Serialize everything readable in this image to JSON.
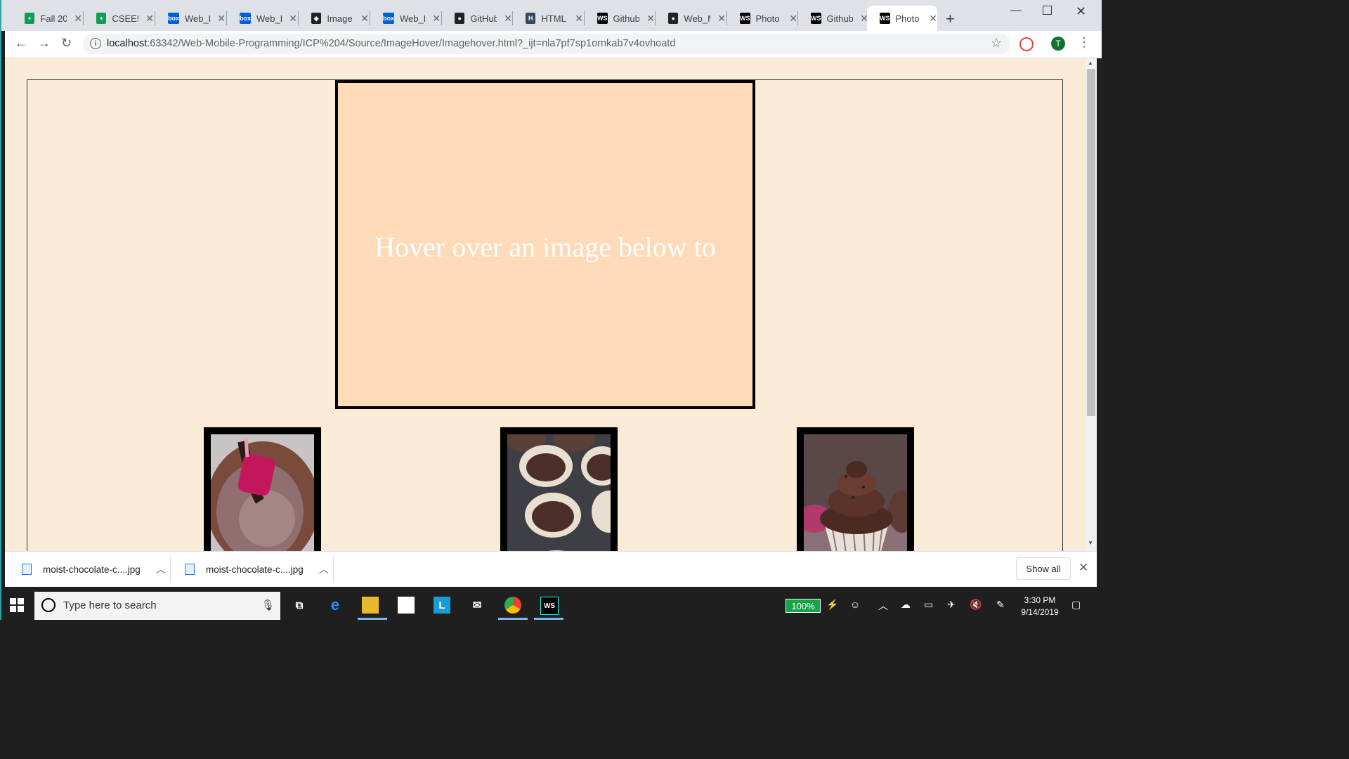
{
  "browser": {
    "tabs": [
      {
        "label": "Fall 20",
        "icon": "sheets-icon",
        "color": "#0f9d58",
        "glyph": "+"
      },
      {
        "label": "CSEE5",
        "icon": "sheets-icon",
        "color": "#0f9d58",
        "glyph": "+"
      },
      {
        "label": "Web_L",
        "icon": "box-icon",
        "color": "#0061d5",
        "glyph": "box"
      },
      {
        "label": "Web_L",
        "icon": "box-icon",
        "color": "#0061d5",
        "glyph": "box"
      },
      {
        "label": "Image",
        "icon": "codepen-icon",
        "color": "#222222",
        "glyph": "◈"
      },
      {
        "label": "Web_L",
        "icon": "box-icon",
        "color": "#0061d5",
        "glyph": "box"
      },
      {
        "label": "GitHub",
        "icon": "github-icon",
        "color": "#222222",
        "glyph": "●"
      },
      {
        "label": "HTML",
        "icon": "html-icon",
        "color": "#34495e",
        "glyph": "H"
      },
      {
        "label": "Github",
        "icon": "webstorm-icon",
        "color": "#000000",
        "glyph": "WS"
      },
      {
        "label": "Web_M",
        "icon": "github-icon",
        "color": "#222222",
        "glyph": "●"
      },
      {
        "label": "Photo",
        "icon": "webstorm-icon",
        "color": "#000000",
        "glyph": "WS"
      },
      {
        "label": "Github",
        "icon": "webstorm-icon",
        "color": "#000000",
        "glyph": "WS"
      },
      {
        "label": "Photo",
        "icon": "webstorm-icon",
        "color": "#000000",
        "glyph": "WS",
        "active": true
      }
    ],
    "url_host": "localhost",
    "url_rest": ":63342/Web-Mobile-Programming/ICP%204/Source/ImageHover/Imagehover.html?_ijt=nla7pf7sp1ornkab7v4ovhoatd",
    "profile_initial": "T"
  },
  "page": {
    "preview_text": "Hover over an image below to",
    "background": "#faebd7",
    "preview_background": "#ffdab9"
  },
  "downloads": {
    "items": [
      {
        "name": "moist-chocolate-c....jpg"
      },
      {
        "name": "moist-chocolate-c....jpg"
      }
    ],
    "show_all": "Show all"
  },
  "taskbar": {
    "search_placeholder": "Type here to search",
    "battery": "100%",
    "time": "3:30 PM",
    "date": "9/14/2019"
  }
}
